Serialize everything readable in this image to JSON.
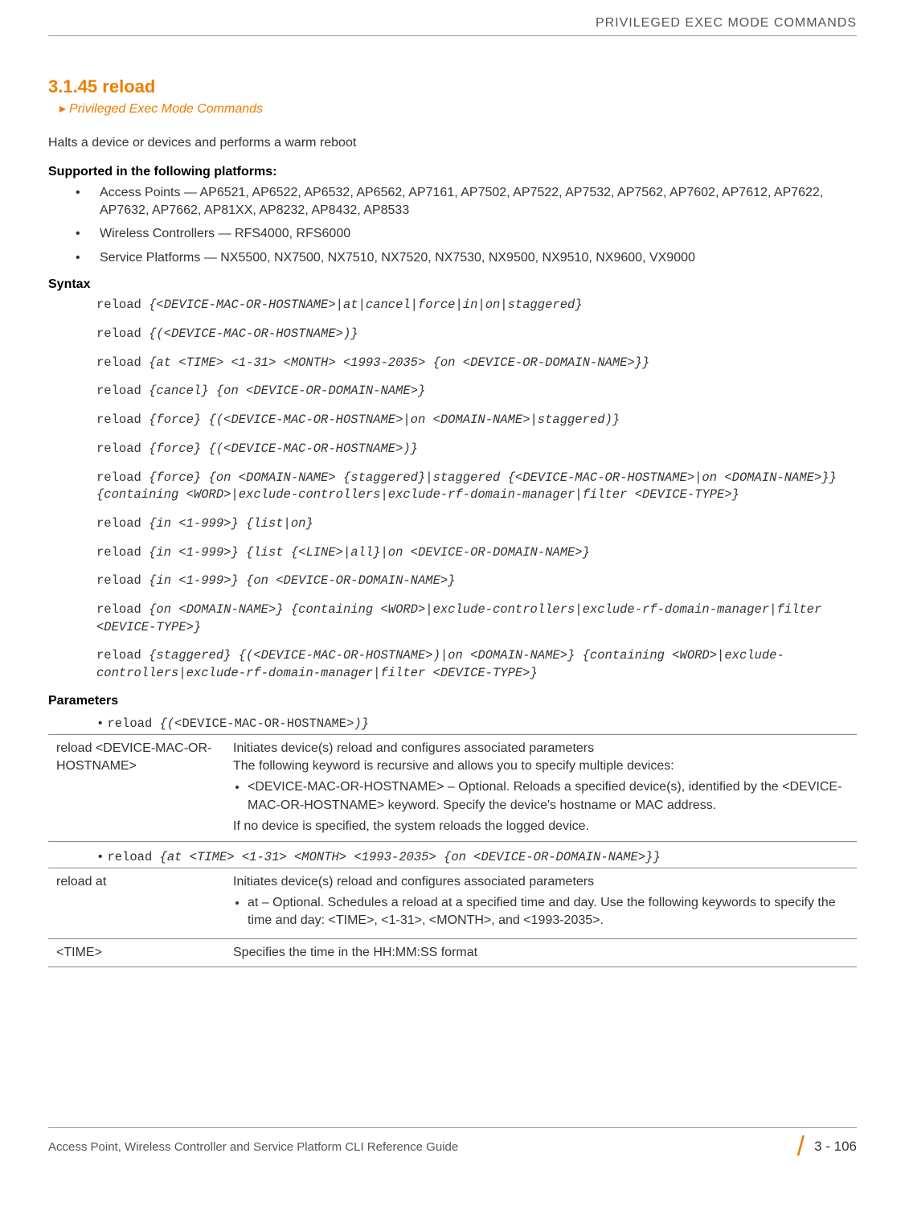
{
  "header": {
    "right_text": "PRIVILEGED EXEC MODE COMMANDS"
  },
  "title": "3.1.45 reload",
  "breadcrumb": "Privileged Exec Mode Commands",
  "intro": "Halts a device or devices and performs a warm reboot",
  "supported_heading": "Supported in the following platforms:",
  "platforms": {
    "ap": "Access Points — AP6521, AP6522, AP6532, AP6562, AP7161, AP7502, AP7522, AP7532, AP7562, AP7602, AP7612, AP7622, AP7632, AP7662, AP81XX, AP8232, AP8432, AP8533",
    "wc": "Wireless Controllers — RFS4000, RFS6000",
    "sp": "Service Platforms — NX5500, NX7500, NX7510, NX7520, NX7530, NX9500, NX9510, NX9600, VX9000"
  },
  "syntax_heading": "Syntax",
  "syntax": {
    "l1_k": "reload ",
    "l1_a": "{<DEVICE-MAC-OR-HOSTNAME>|at|cancel|force|in|on|staggered}",
    "l2_k": "reload ",
    "l2_a": "{(<DEVICE-MAC-OR-HOSTNAME>)}",
    "l3_k": "reload ",
    "l3_a": "{at <TIME> <1-31> <MONTH> <1993-2035> {on <DEVICE-OR-DOMAIN-NAME>}}",
    "l4_k": "reload ",
    "l4_a": "{cancel} {on <DEVICE-OR-DOMAIN-NAME>}",
    "l5_k": "reload ",
    "l5_a": "{force} {(<DEVICE-MAC-OR-HOSTNAME>|on <DOMAIN-NAME>|staggered)}",
    "l6_k": "reload ",
    "l6_a": "{force} {(<DEVICE-MAC-OR-HOSTNAME>)}",
    "l7_k": "reload ",
    "l7_a": "{force} {on <DOMAIN-NAME> {staggered}|staggered {<DEVICE-MAC-OR-HOSTNAME>|on <DOMAIN-NAME>}} {containing <WORD>|exclude-controllers|exclude-rf-domain-manager|filter <DEVICE-TYPE>}",
    "l8_k": "reload ",
    "l8_a": "{in <1-999>} {list|on}",
    "l9_k": "reload ",
    "l9_a": "{in <1-999>} {list {<LINE>|all}|on <DEVICE-OR-DOMAIN-NAME>}",
    "l10_k": "reload ",
    "l10_a": "{in <1-999>} {on <DEVICE-OR-DOMAIN-NAME>}",
    "l11_k": "reload ",
    "l11_a": "{on <DOMAIN-NAME>} {containing <WORD>|exclude-controllers|exclude-rf-domain-manager|filter <DEVICE-TYPE>}",
    "l12_k": "reload ",
    "l12_a": "{staggered} {(<DEVICE-MAC-OR-HOSTNAME>)|on <DOMAIN-NAME>} {containing <WORD>|exclude-controllers|exclude-rf-domain-manager|filter <DEVICE-TYPE>}"
  },
  "parameters_heading": "Parameters",
  "param1_intro_kw": "reload ",
  "param1_intro_arg": "{(",
  "param1_intro_mid": "<DEVICE-MAC-OR-HOSTNAME>",
  "param1_intro_end": ")}",
  "table1": {
    "key": "reload <DEVICE-MAC-OR-HOSTNAME>",
    "desc_line1": "Initiates device(s) reload and configures associated parameters",
    "desc_line2": "The following keyword is recursive and allows you to specify multiple devices:",
    "desc_bullet": "<DEVICE-MAC-OR-HOSTNAME> – Optional. Reloads a specified device(s), identified by the <DEVICE-MAC-OR-HOSTNAME> keyword. Specify the device's hostname or MAC address.",
    "desc_line3": "If no device is specified, the system reloads the logged device."
  },
  "param2_intro_kw": "reload ",
  "param2_intro_arg": "{at <TIME> <1-31> <MONTH> <1993-2035> {on <DEVICE-OR-DOMAIN-NAME>}}",
  "table2": {
    "r1_key": "reload at",
    "r1_desc_line1": "Initiates device(s) reload and configures associated parameters",
    "r1_desc_bullet": "at – Optional. Schedules a reload at a specified time and day. Use the following keywords to specify the time and day: <TIME>, <1-31>, <MONTH>, and <1993-2035>.",
    "r2_key": "<TIME>",
    "r2_desc": "Specifies the time in the HH:MM:SS format"
  },
  "footer": {
    "left": "Access Point, Wireless Controller and Service Platform CLI Reference Guide",
    "pagenum": "3 - 106"
  }
}
